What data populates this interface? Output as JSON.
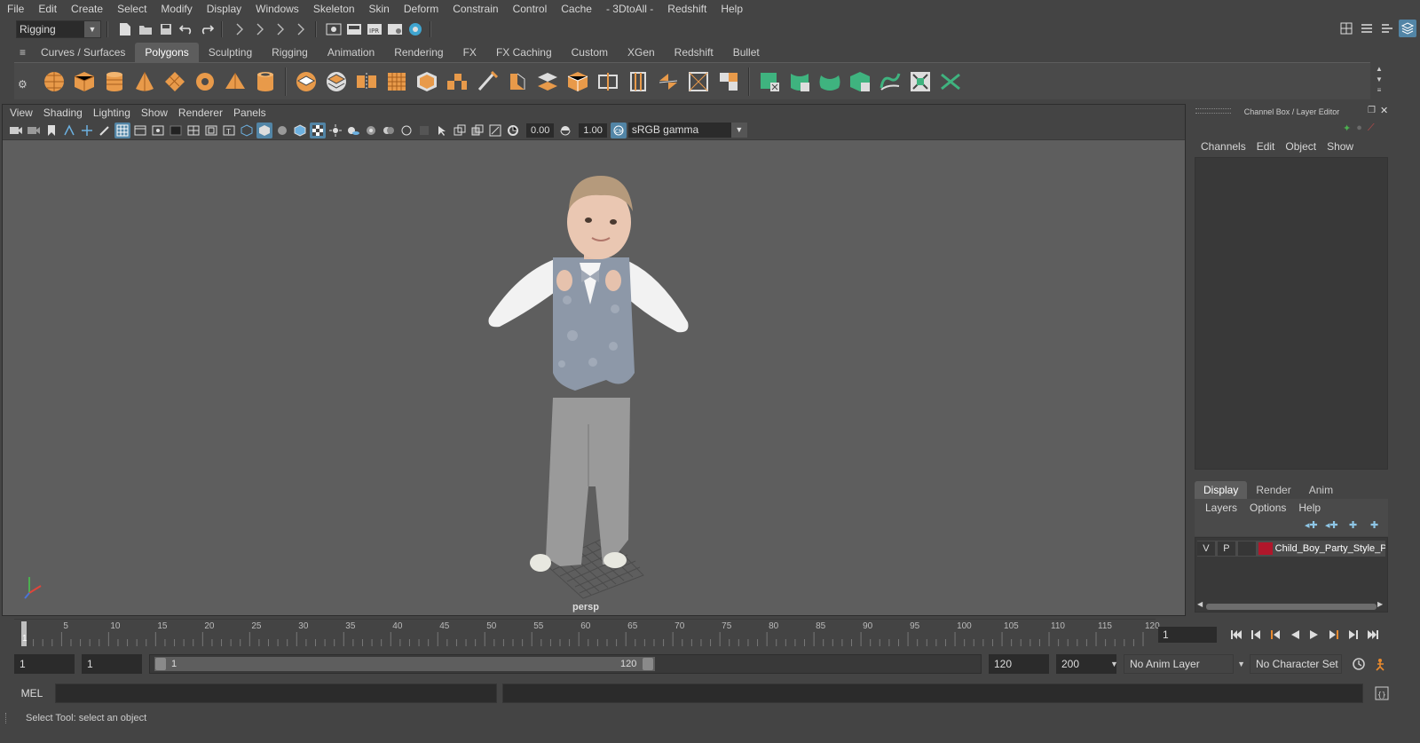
{
  "menubar": {
    "items": [
      "File",
      "Edit",
      "Create",
      "Select",
      "Modify",
      "Display",
      "Windows",
      "Skeleton",
      "Skin",
      "Deform",
      "Constrain",
      "Control",
      "Cache",
      "- 3DtoAll -",
      "Redshift",
      "Help"
    ]
  },
  "statusline": {
    "mode": "Rigging"
  },
  "shelf": {
    "tabs": [
      "Curves / Surfaces",
      "Polygons",
      "Sculpting",
      "Rigging",
      "Animation",
      "Rendering",
      "FX",
      "FX Caching",
      "Custom",
      "XGen",
      "Redshift",
      "Bullet"
    ],
    "active_tab": "Polygons"
  },
  "viewport": {
    "menus": [
      "View",
      "Shading",
      "Lighting",
      "Show",
      "Renderer",
      "Panels"
    ],
    "exposure": "0.00",
    "gamma": "1.00",
    "color_space": "sRGB gamma",
    "camera": "persp"
  },
  "channelbox": {
    "title": "Channel Box / Layer Editor",
    "menus": [
      "Channels",
      "Edit",
      "Object",
      "Show"
    ]
  },
  "layer_editor": {
    "tabs": [
      "Display",
      "Render",
      "Anim"
    ],
    "active_tab": "Display",
    "menus": [
      "Layers",
      "Options",
      "Help"
    ],
    "layer": {
      "visible": "V",
      "playback": "P",
      "name": "Child_Boy_Party_Style_Po",
      "color": "#b0172b"
    }
  },
  "timeline": {
    "ticks": [
      "5",
      "10",
      "15",
      "20",
      "25",
      "30",
      "35",
      "40",
      "45",
      "50",
      "55",
      "60",
      "65",
      "70",
      "75",
      "80",
      "85",
      "90",
      "95",
      "100",
      "105",
      "110",
      "115",
      "120"
    ],
    "first_tick": "1",
    "current_frame": "1"
  },
  "range": {
    "start": "1",
    "playback_start": "1",
    "slider_start": "1",
    "slider_end": "120",
    "playback_end": "120",
    "end": "200",
    "anim_layer": "No Anim Layer",
    "character_set": "No Character Set"
  },
  "cmdline": {
    "label": "MEL"
  },
  "helpline": {
    "text": "Select Tool: select an object"
  }
}
